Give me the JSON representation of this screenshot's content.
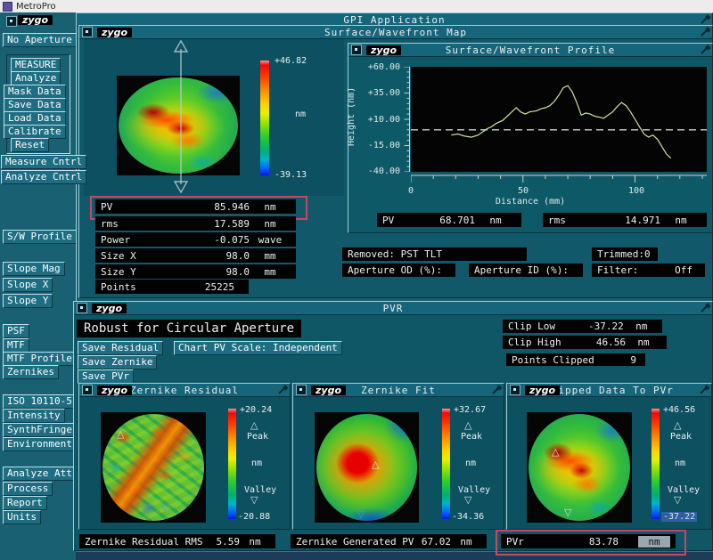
{
  "os": {
    "title": "MetroPro"
  },
  "logo": "zygo",
  "colors": {
    "highlight_box": "#c8485c",
    "profile_line": "#cde3a2"
  },
  "gpi": {
    "title": "GPI Application"
  },
  "sidebar": {
    "no_aperture": "No Aperture",
    "measure_group": [
      "MEASURE",
      "Analyze",
      "Mask Data",
      "Save Data",
      "Load Data",
      "Calibrate",
      "Reset"
    ],
    "cntrl": [
      "Measure Cntrl",
      "Analyze Cntrl"
    ],
    "sw_profile": "S/W Profile",
    "slope": [
      "Slope Mag",
      "Slope X",
      "Slope Y"
    ],
    "optics": [
      "PSF",
      "MTF",
      "MTF Profile",
      "Zernikes"
    ],
    "misc": [
      "ISO 10110-5",
      "Intensity",
      "SynthFringes",
      "Environment"
    ],
    "bottom": [
      "Analyze Attr",
      "Process",
      "Report",
      "Units"
    ]
  },
  "map_window": {
    "title": "Surface/Wavefront Map",
    "colorbar": {
      "max": "+46.82",
      "min": "-39.13",
      "units": "nm"
    },
    "stats": [
      {
        "label": "PV",
        "value": "85.946",
        "units": "nm"
      },
      {
        "label": "rms",
        "value": "17.589",
        "units": "nm"
      },
      {
        "label": "Power",
        "value": "-0.075",
        "units": "wave"
      },
      {
        "label": "Size X",
        "value": "98.0",
        "units": "mm"
      },
      {
        "label": "Size Y",
        "value": "98.0",
        "units": "mm"
      },
      {
        "label": "Points",
        "value": "25225",
        "units": ""
      }
    ],
    "removed": "Removed: PST TLT",
    "trimmed": {
      "label": "Trimmed:",
      "value": "0"
    },
    "aperture_od": "Aperture OD (%):",
    "aperture_id": "Aperture ID (%):",
    "filter": {
      "label": "Filter:",
      "value": "Off"
    }
  },
  "profile_window": {
    "title": "Surface/Wavefront Profile",
    "pv": {
      "label": "PV",
      "value": "68.701",
      "units": "nm"
    },
    "rms": {
      "label": "rms",
      "value": "14.971",
      "units": "nm"
    }
  },
  "chart_data": {
    "type": "line",
    "title": "Surface/Wavefront Profile",
    "xlabel": "Distance (mm)",
    "ylabel": "Height (nm)",
    "xlim": [
      0,
      132
    ],
    "ylim": [
      -40,
      60
    ],
    "yticks": [
      "+60.00",
      "+35.00",
      "+10.00",
      "-15.00",
      "-40.00"
    ],
    "xticks": [
      "0",
      "50",
      "100"
    ],
    "xtick_values": [
      0,
      50,
      100
    ],
    "zero_line": 0,
    "grid": false,
    "x": [
      18,
      21,
      24,
      27,
      30,
      32,
      34,
      36,
      38,
      41,
      43,
      45,
      47,
      49,
      51,
      53,
      56,
      58,
      60,
      62,
      64,
      66,
      68,
      70,
      72,
      74,
      76,
      78,
      80,
      82,
      84,
      86,
      88,
      90,
      92,
      94,
      96,
      98,
      100,
      102,
      104,
      106,
      108,
      110,
      112,
      114,
      116
    ],
    "y": [
      -5,
      -4,
      -6,
      -7,
      -5,
      -2,
      1,
      3,
      6,
      9,
      13,
      17,
      21,
      17,
      15,
      17,
      18,
      20,
      21,
      23,
      27,
      33,
      40,
      42,
      36,
      26,
      14,
      16,
      15,
      13,
      12,
      11,
      14,
      17,
      22,
      26,
      23,
      17,
      10,
      3,
      -4,
      -7,
      -5,
      -9,
      -16,
      -23,
      -27
    ]
  },
  "pvr_window": {
    "title": "PVR",
    "heading": "Robust for Circular Aperture",
    "save_residual": "Save Residual",
    "chart_pv_scale": "Chart PV Scale: Independent",
    "save_zernike": "Save Zernike",
    "save_pvr": "Save PVr",
    "clip_low": {
      "label": "Clip Low",
      "value": "-37.22",
      "units": "nm"
    },
    "clip_high": {
      "label": "Clip High",
      "value": "46.56",
      "units": "nm"
    },
    "points_clipped": {
      "label": "Points Clipped",
      "value": "9"
    },
    "maps": [
      {
        "title": "Zernike Residual",
        "colorbar": {
          "max": "+20.24",
          "min": "-20.88",
          "units": "nm",
          "peak": "Peak",
          "valley": "Valley"
        }
      },
      {
        "title": "Zernike Fit",
        "colorbar": {
          "max": "+32.67",
          "min": "-34.36",
          "units": "nm",
          "peak": "Peak",
          "valley": "Valley"
        }
      },
      {
        "title": "Clipped Data To PVr",
        "colorbar": {
          "max": "+46.56",
          "min": "-37.22",
          "units": "nm",
          "peak": "Peak",
          "valley": "Valley"
        }
      }
    ],
    "results": [
      {
        "label": "Zernike Residual RMS",
        "value": "5.59",
        "units": "nm"
      },
      {
        "label": "Zernike Generated PV",
        "value": "67.02",
        "units": "nm"
      },
      {
        "label": "PVr",
        "value": "83.78",
        "units": "nm"
      }
    ]
  }
}
